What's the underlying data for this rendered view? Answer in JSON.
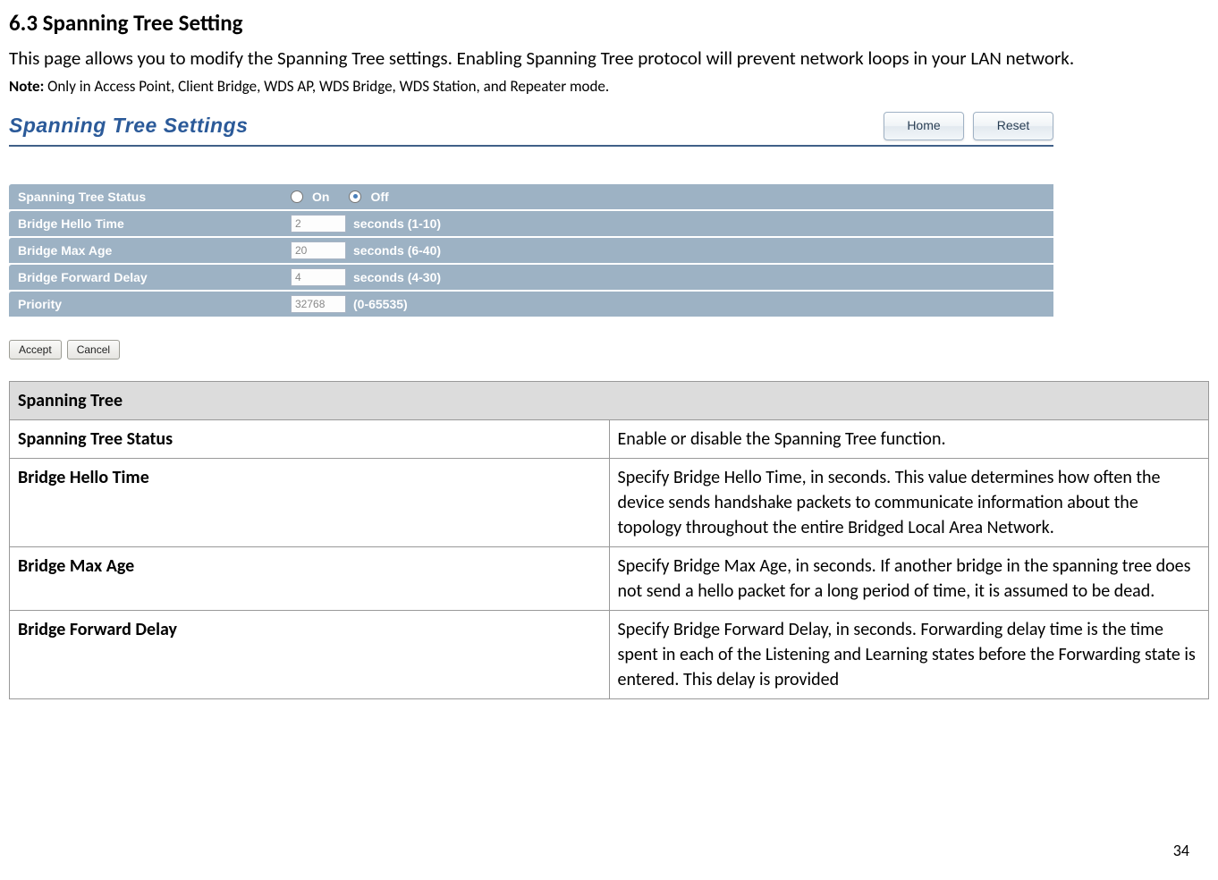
{
  "heading": "6.3   Spanning Tree Setting",
  "intro": "This page allows you to modify the Spanning Tree settings. Enabling Spanning Tree protocol will prevent network loops in your LAN network.",
  "note_prefix": "Note:",
  "note_body": " Only in Access Point, Client Bridge, WDS AP, WDS Bridge, WDS Station, and Repeater mode.",
  "ss": {
    "title": "Spanning Tree Settings",
    "home_btn": "Home",
    "reset_btn": "Reset",
    "rows": [
      {
        "label": "Spanning Tree Status",
        "type": "radio",
        "opt_on": "On",
        "opt_off": "Off",
        "selected": "off"
      },
      {
        "label": "Bridge Hello Time",
        "type": "num",
        "value": "2",
        "suffix": "seconds (1-10)"
      },
      {
        "label": "Bridge Max Age",
        "type": "num",
        "value": "20",
        "suffix": "seconds (6-40)"
      },
      {
        "label": "Bridge Forward Delay",
        "type": "num",
        "value": "4",
        "suffix": "seconds (4-30)"
      },
      {
        "label": "Priority",
        "type": "num",
        "value": "32768",
        "suffix": "(0-65535)"
      }
    ],
    "accept_btn": "Accept",
    "cancel_btn": "Cancel"
  },
  "table": {
    "header": "Spanning Tree",
    "rows": [
      {
        "name": "Spanning Tree Status",
        "desc": "Enable or disable the Spanning Tree function."
      },
      {
        "name": "Bridge Hello Time",
        "desc": "Specify Bridge Hello Time, in seconds. This value determines how often the device sends handshake packets to communicate information about the topology throughout the entire Bridged Local Area Network."
      },
      {
        "name": "Bridge Max Age",
        "desc": "Specify Bridge Max Age, in seconds. If another bridge in the spanning tree does not send a hello packet for a long period of time, it is assumed to be dead."
      },
      {
        "name": "Bridge Forward Delay",
        "desc": "Specify Bridge Forward Delay, in seconds. Forwarding delay time is the time spent in each of the Listening and Learning states before the Forwarding state is entered. This delay is provided"
      }
    ]
  },
  "page_number": "34"
}
